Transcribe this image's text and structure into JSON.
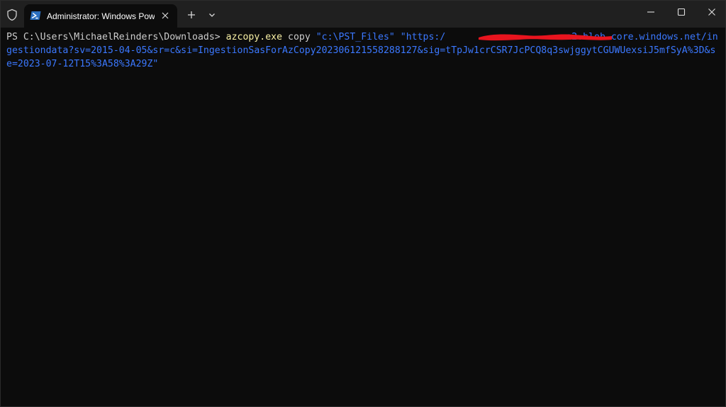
{
  "titlebar": {
    "tab_title": "Administrator: Windows PowerShell",
    "icons": {
      "shield": "shield-icon",
      "powershell": "powershell-icon",
      "tab_close": "close-icon",
      "new_tab": "plus-icon",
      "dropdown": "chevron-down-icon",
      "minimize": "minimize-icon",
      "maximize": "maximize-icon",
      "close": "close-icon"
    }
  },
  "terminal": {
    "prompt": "PS C:\\Users\\MichaelReinders\\Downloads> ",
    "command": "azcopy.exe",
    "argument": " copy ",
    "source": "\"c:\\PST_Files\"",
    "destination_start": " \"https:/",
    "destination_rest": "a2.blob.core.windows.net/ingestiondata?sv=2015-04-05&sr=c&si=IngestionSasForAzCopy202306121558288127&sig=tTpJw1crCSR7JcPCQ8q3swjggytCGUWUexsiJ5mfSyA%3D&se=2023-07-12T15%3A58%3A29Z\""
  },
  "colors": {
    "background": "#0c0c0c",
    "titlebar": "#202020",
    "command": "#f9f1a5",
    "string": "#3b78ff",
    "text": "#cccccc",
    "redaction": "#e8141e"
  }
}
